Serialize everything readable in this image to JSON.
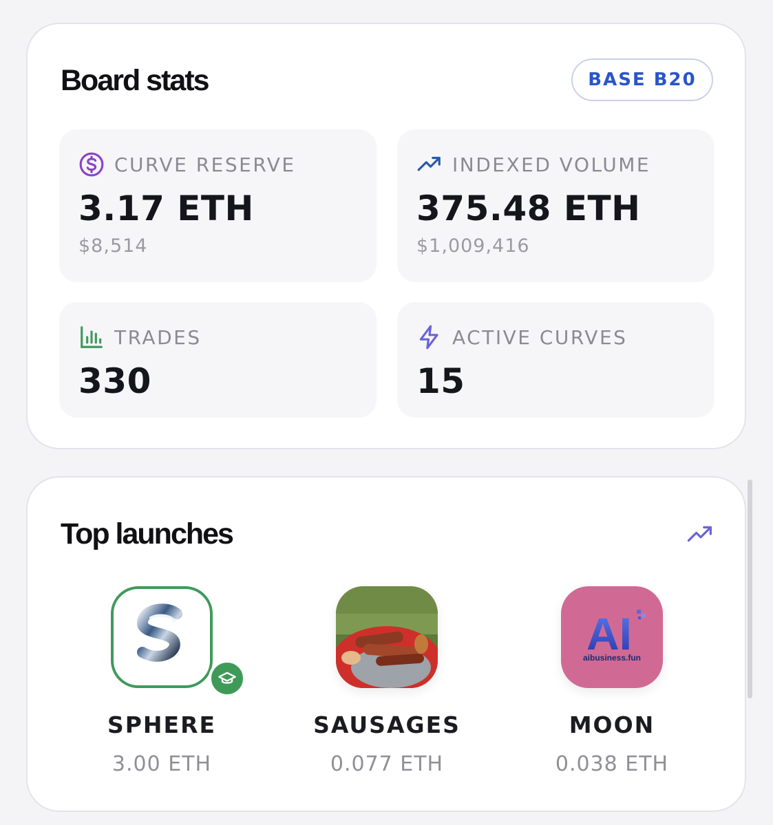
{
  "board_stats": {
    "title": "Board stats",
    "chain_chip": "BASE B20",
    "stats": [
      {
        "icon": "dollar-circle-icon",
        "label": "CURVE RESERVE",
        "value": "3.17 ETH",
        "sub": "$8,514",
        "accent": "#8a44c8"
      },
      {
        "icon": "trending-up-icon",
        "label": "INDEXED VOLUME",
        "value": "375.48 ETH",
        "sub": "$1,009,416",
        "accent": "#2a5aa8"
      },
      {
        "icon": "bar-chart-icon",
        "label": "TRADES",
        "value": "330",
        "accent": "#3f9a5a"
      },
      {
        "icon": "lightning-icon",
        "label": "ACTIVE CURVES",
        "value": "15",
        "accent": "#6a63d8"
      }
    ]
  },
  "top_launches": {
    "title": "Top launches",
    "trend_icon": "trending-up-icon",
    "tokens": [
      {
        "name": "SPHERE",
        "amount": "3.00 ETH",
        "badge": "graduation-cap-icon"
      },
      {
        "name": "SAUSAGES",
        "amount": "0.077 ETH"
      },
      {
        "name": "MOON",
        "amount": "0.038 ETH",
        "logo_text": "aibusiness.fun",
        "logo_mark": "AI"
      }
    ]
  },
  "colors": {
    "chip_text": "#2a55c9",
    "graduated_green": "#3f9a5a"
  }
}
